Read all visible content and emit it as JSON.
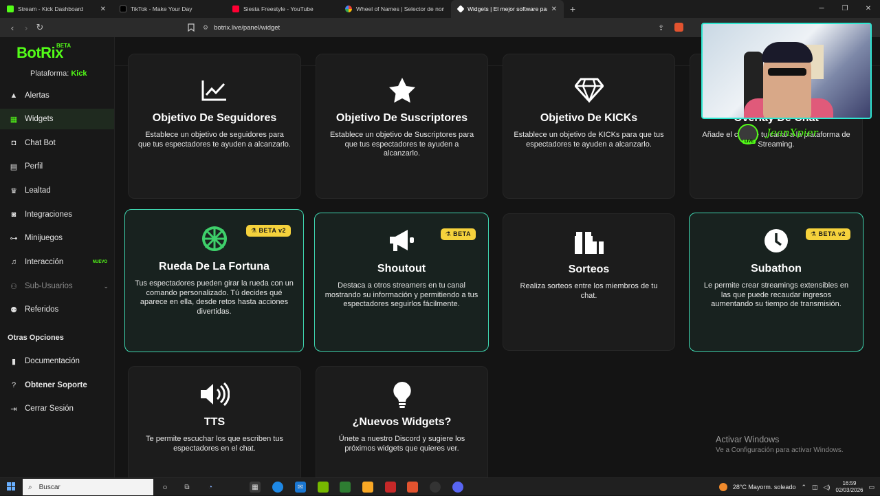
{
  "browser": {
    "tabs": [
      {
        "title": "Stream - Kick Dashboard",
        "color": "#53fc18",
        "active": false
      },
      {
        "title": "TikTok - Make Your Day",
        "color": "#111111",
        "active": false
      },
      {
        "title": "Siesta Freestyle - YouTube",
        "color": "#ff0033",
        "active": false
      },
      {
        "title": "Wheel of Names | Selector de nombr",
        "color": "#4285f4",
        "active": false
      },
      {
        "title": "Widgets | El mejor software para",
        "color": "#ffffff",
        "active": true
      }
    ],
    "url": "botrix.live/panel/widget"
  },
  "sidebar": {
    "logo": "BotRix",
    "logo_badge": "BETA",
    "platform_label": "Plataforma:",
    "platform_value": "Kick",
    "items": [
      {
        "label": "Alertas",
        "icon": "warning-icon"
      },
      {
        "label": "Widgets",
        "icon": "grid-icon"
      },
      {
        "label": "Chat Bot",
        "icon": "robot-icon"
      },
      {
        "label": "Perfil",
        "icon": "id-card-icon"
      },
      {
        "label": "Lealtad",
        "icon": "trophy-icon"
      },
      {
        "label": "Integraciones",
        "icon": "plug-icon"
      },
      {
        "label": "Minijuegos",
        "icon": "gamepad-icon"
      },
      {
        "label": "Interacción",
        "icon": "music-icon",
        "badge": "NUEVO"
      },
      {
        "label": "Sub-Usuarios",
        "icon": "users-icon"
      },
      {
        "label": "Referidos",
        "icon": "user-friends-icon"
      }
    ],
    "other_title": "Otras Opciones",
    "other_items": [
      {
        "label": "Documentación",
        "icon": "book-icon"
      },
      {
        "label": "Obtener Soporte",
        "icon": "question-icon"
      },
      {
        "label": "Cerrar Sesión",
        "icon": "logout-icon"
      }
    ]
  },
  "widgets": [
    {
      "title": "Objetivo De Seguidores",
      "desc": "Establece un objetivo de seguidores para que tus espectadores te ayuden a alcanzarlo.",
      "icon": "chart-line-icon"
    },
    {
      "title": "Objetivo De Suscriptores",
      "desc": "Establece un objetivo de Suscriptores para que tus espectadores te ayuden a alcanzarlo.",
      "icon": "star-icon"
    },
    {
      "title": "Objetivo De KICKs",
      "desc": "Establece un objetivo de KICKs para que tus espectadores te ayuden a alcanzarlo.",
      "icon": "diamond-icon"
    },
    {
      "title": "Overlay De Chat",
      "desc": "Añade el chat de tu canal a la plataforma de Streaming.",
      "icon": "chat-icon"
    },
    {
      "title": "Rueda De La Fortuna",
      "desc": "Tus espectadores pueden girar la rueda con un comando personalizado. Tú decides qué aparece en ella, desde retos hasta acciones divertidas.",
      "icon": "wheel-icon",
      "badge": "BETA v2"
    },
    {
      "title": "Shoutout",
      "desc": "Destaca a otros streamers en tu canal mostrando su información y permitiendo a tus espectadores seguirlos fácilmente.",
      "icon": "megaphone-icon",
      "badge": "BETA"
    },
    {
      "title": "Sorteos",
      "desc": "Realiza sorteos entre los miembros de tu chat.",
      "icon": "gift-icon"
    },
    {
      "title": "Subathon",
      "desc": "Le permite crear streamings extensibles en las que puede recaudar ingresos aumentando su tiempo de transmisión.",
      "icon": "clock-icon",
      "badge": "BETA v2"
    },
    {
      "title": "TTS",
      "desc": "Te permite escuchar los que escriben tus espectadores en el chat.",
      "icon": "volume-icon"
    },
    {
      "title": "¿Nuevos Widgets?",
      "desc": "Únete a nuestro Discord y sugiere los próximos widgets que quieres ver.",
      "icon": "lightbulb-icon"
    }
  ],
  "overlay": {
    "streamer": "JeanXpier",
    "live": "LIVE"
  },
  "windows": {
    "activate_title": "Activar Windows",
    "activate_sub": "Ve a Configuración para activar Windows."
  },
  "taskbar": {
    "search_placeholder": "Buscar",
    "weather": "28°C  Mayorm. soleado",
    "time": "16:59",
    "date": "02/03/2026"
  },
  "colors": {
    "accent": "#53fc18",
    "highlight_border": "#3fd6b0",
    "beta_badge": "#f5d23c"
  }
}
